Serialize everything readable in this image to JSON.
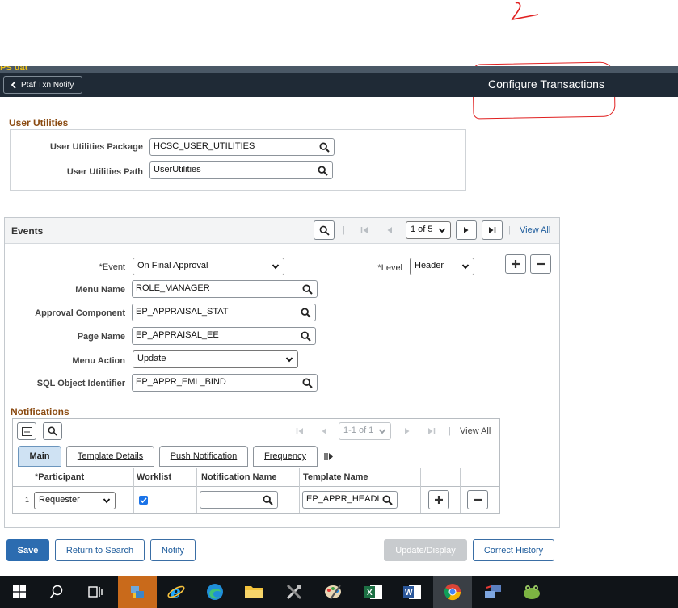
{
  "top_strip": {
    "env_label": "PS uat"
  },
  "header": {
    "back_label": "Ptaf Txn Notify",
    "page_title": "Configure Transactions"
  },
  "user_utilities": {
    "section_title": "User Utilities",
    "package_label": "User Utilities Package",
    "package_value": "HCSC_USER_UTILITIES",
    "path_label": "User Utilities Path",
    "path_value": "UserUtilities"
  },
  "events": {
    "title": "Events",
    "pager": "1 of 5",
    "view_all": "View All",
    "event_label": "*Event",
    "event_value": "On Final Approval",
    "level_label": "*Level",
    "level_value": "Header",
    "menu_name_label": "Menu Name",
    "menu_name_value": "ROLE_MANAGER",
    "approval_component_label": "Approval Component",
    "approval_component_value": "EP_APPRAISAL_STAT",
    "page_name_label": "Page Name",
    "page_name_value": "EP_APPRAISAL_EE",
    "menu_action_label": "Menu Action",
    "menu_action_value": "Update",
    "sql_object_label": "SQL Object Identifier",
    "sql_object_value": "EP_APPR_EML_BIND"
  },
  "notifications": {
    "title": "Notifications",
    "pager": "1-1 of 1",
    "view_all": "View All",
    "tabs": [
      {
        "label": "Main"
      },
      {
        "label": "Template Details"
      },
      {
        "label": "Push Notification"
      },
      {
        "label": "Frequency"
      }
    ],
    "columns": [
      "Participant",
      "Worklist",
      "Notification Name",
      "Template Name"
    ],
    "required_marker": "*",
    "rows": [
      {
        "num": "1",
        "participant": "Requester",
        "worklist_checked": true,
        "notification_name": "",
        "template_name": "EP_APPR_HEADI"
      }
    ]
  },
  "footer": {
    "save": "Save",
    "return_to_search": "Return to Search",
    "notify": "Notify",
    "update_display": "Update/Display",
    "correct_history": "Correct History"
  },
  "colors": {
    "header_bg": "#1f2a36",
    "section_title": "#8a4a10",
    "link": "#1e5c9c",
    "primary_button": "#2c6cb0",
    "annotation": "#e02020"
  },
  "taskbar": {
    "items": [
      "windows-start-icon",
      "search-icon",
      "task-view-icon",
      "app-icon",
      "internet-explorer-icon",
      "edge-icon",
      "file-explorer-icon",
      "tools-icon",
      "paint-icon",
      "excel-icon",
      "word-icon",
      "chrome-icon",
      "network-icon",
      "frog-app-icon"
    ]
  }
}
